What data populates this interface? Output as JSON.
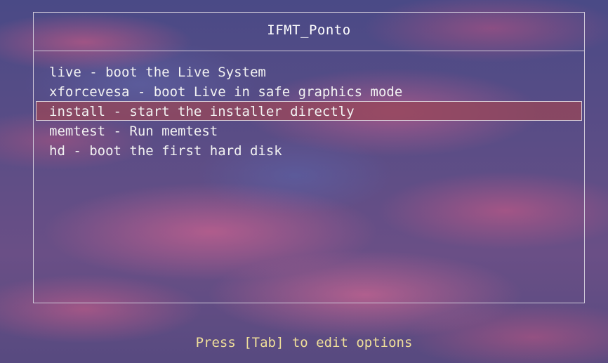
{
  "menu": {
    "title": "IFMT_Ponto",
    "items": [
      {
        "label": "live - boot the Live System",
        "selected": false
      },
      {
        "label": "xforcevesa - boot Live in safe graphics mode",
        "selected": false
      },
      {
        "label": "install - start the installer directly",
        "selected": true
      },
      {
        "label": "memtest - Run memtest",
        "selected": false
      },
      {
        "label": "hd - boot the first hard disk",
        "selected": false
      }
    ]
  },
  "footer": {
    "hint": "Press [Tab] to edit options"
  },
  "colors": {
    "text": "#f2f2f2",
    "title": "#ffffff",
    "hint": "#f0df9a",
    "border": "#cfc8d8",
    "selection": "#96465a"
  }
}
